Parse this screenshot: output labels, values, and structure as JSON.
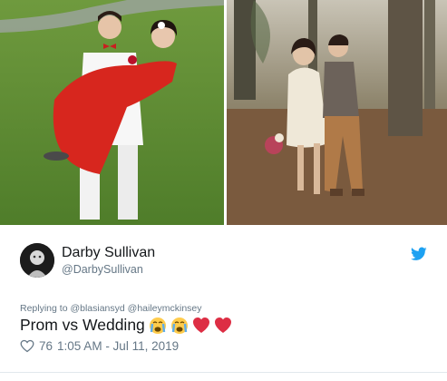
{
  "images": {
    "left": {
      "semantic": "prom-photo",
      "alt": ""
    },
    "right": {
      "semantic": "wedding-photo",
      "alt": ""
    }
  },
  "tweet": {
    "author": {
      "display_name": "Darby Sullivan",
      "handle": "@DarbySullivan"
    },
    "reply_prefix": "Replying to",
    "reply_to": [
      "@blasiansyd",
      "@haileymckinsey"
    ],
    "text": "Prom vs Wedding",
    "emojis": [
      "loudly-crying-face",
      "loudly-crying-face",
      "red-heart",
      "red-heart"
    ],
    "likes": "76",
    "timestamp": "1:05 AM - Jul 11, 2019"
  },
  "icons": {
    "brand": "twitter-bird-icon",
    "like": "heart-outline-icon"
  },
  "colors": {
    "twitter_blue": "#1da1f2",
    "text_primary": "#14171a",
    "text_secondary": "#657786",
    "heart_red": "#e0245e"
  }
}
